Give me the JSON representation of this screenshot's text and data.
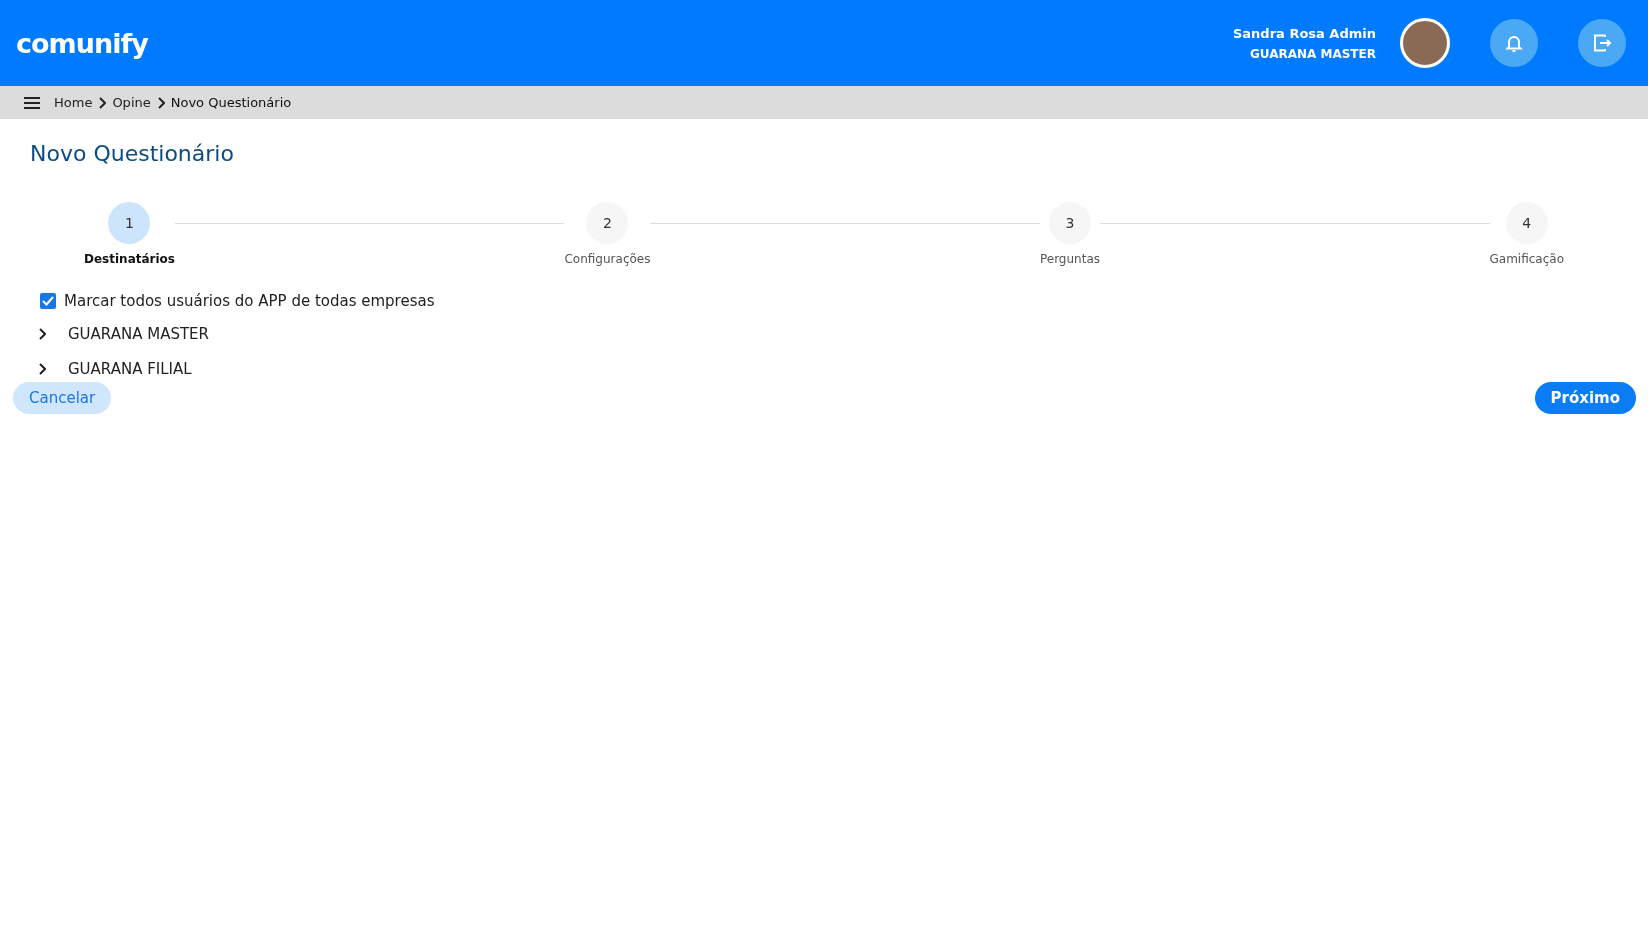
{
  "header": {
    "logo": "comunify",
    "user_name": "Sandra Rosa Admin",
    "company": "GUARANA MASTER"
  },
  "breadcrumb": [
    "Home",
    "Opine",
    "Novo Questionário"
  ],
  "page_title": "Novo Questionário",
  "steps": [
    {
      "number": "1",
      "label": "Destinatários",
      "selected": true
    },
    {
      "number": "2",
      "label": "Configurações",
      "selected": false
    },
    {
      "number": "3",
      "label": "Perguntas",
      "selected": false
    },
    {
      "number": "4",
      "label": "Gamificação",
      "selected": false
    }
  ],
  "select_all": {
    "label": "Marcar todos usuários do APP de todas empresas",
    "checked": true
  },
  "companies": [
    {
      "name": "GUARANA MASTER",
      "expanded": false
    },
    {
      "name": "GUARANA FILIAL",
      "expanded": false
    }
  ],
  "buttons": {
    "cancel": "Cancelar",
    "next": "Próximo"
  }
}
